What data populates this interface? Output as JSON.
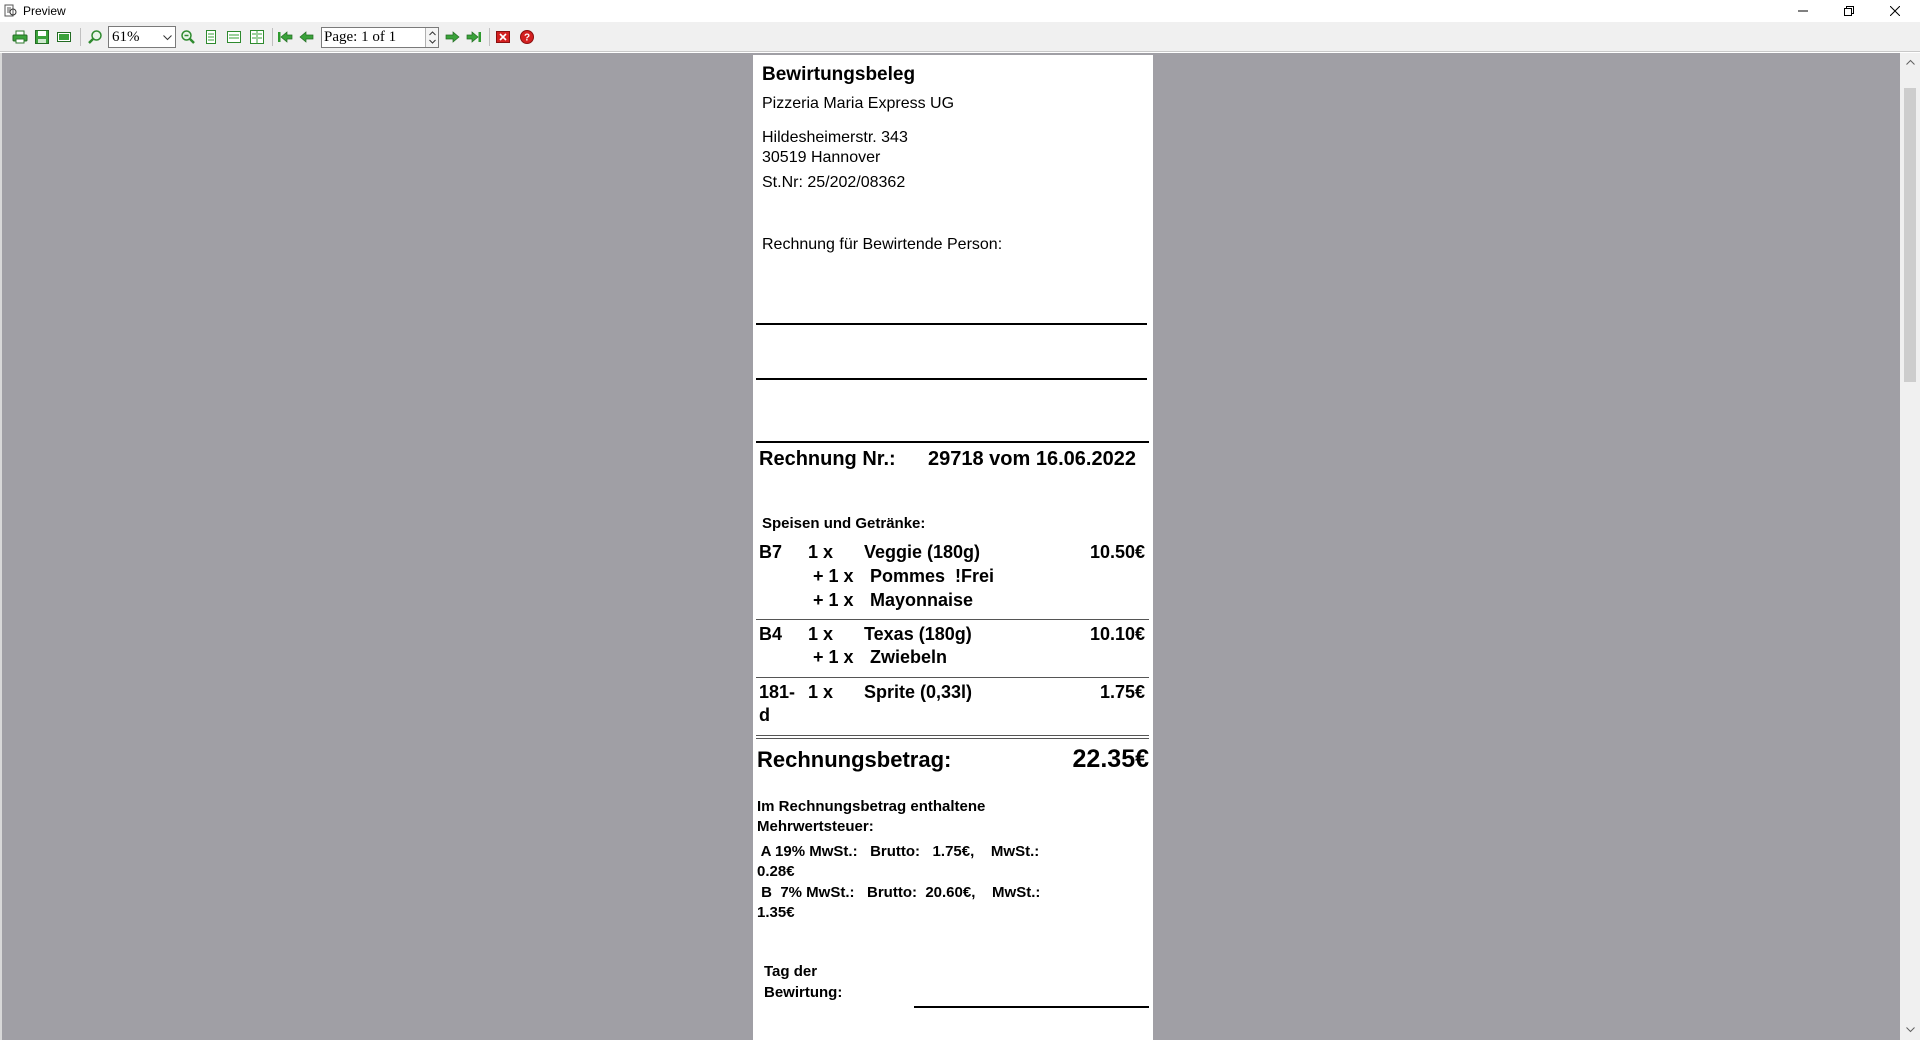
{
  "window": {
    "title": "Preview"
  },
  "toolbar": {
    "zoom": "61%",
    "page_indicator": "Page: 1 of 1"
  },
  "receipt": {
    "heading": "Bewirtungsbeleg",
    "company": "Pizzeria Maria Express UG",
    "street": "Hildesheimerstr. 343",
    "city": "30519 Hannover",
    "tax_number": "St.Nr: 25/202/08362",
    "host_label": "Rechnung für Bewirtende Person:",
    "invoice_label": "Rechnung Nr.:",
    "invoice_value": "29718 vom 16.06.2022",
    "items_heading": "Speisen und Getränke:",
    "items": [
      {
        "code": "B7",
        "qty": "1 x",
        "name": "Veggie (180g)",
        "price": "10.50€",
        "extras": [
          {
            "qty": "+ 1 x",
            "name": "Pommes  !Frei"
          },
          {
            "qty": "+ 1 x",
            "name": "Mayonnaise"
          }
        ]
      },
      {
        "code": "B4",
        "qty": "1 x",
        "name": "Texas (180g)",
        "price": "10.10€",
        "extras": [
          {
            "qty": "+ 1 x",
            "name": "Zwiebeln"
          }
        ]
      },
      {
        "code": "181-",
        "code2": "d",
        "qty": "1 x",
        "name": "Sprite (0,33l)",
        "price": "1.75€",
        "extras": []
      }
    ],
    "total_label": "Rechnungsbetrag:",
    "total_value": "22.35€",
    "vat_heading_1": "Im Rechnungsbetrag enthaltene",
    "vat_heading_2": "Mehrwertsteuer:",
    "vat_a_line": " A 19% MwSt.:   Brutto:   1.75€,    MwSt.:",
    "vat_a_value": "0.28€",
    "vat_b_line": " B  7% MwSt.:   Brutto:  20.60€,    MwSt.:",
    "vat_b_value": "1.35€",
    "day_label_1": "Tag der",
    "day_label_2": "Bewirtung:"
  },
  "colors": {
    "viewport_bg": "#a09fa5",
    "toolbar_bg": "#f0f0f0",
    "icon_green": "#2e9a2e",
    "icon_red": "#d32020"
  }
}
